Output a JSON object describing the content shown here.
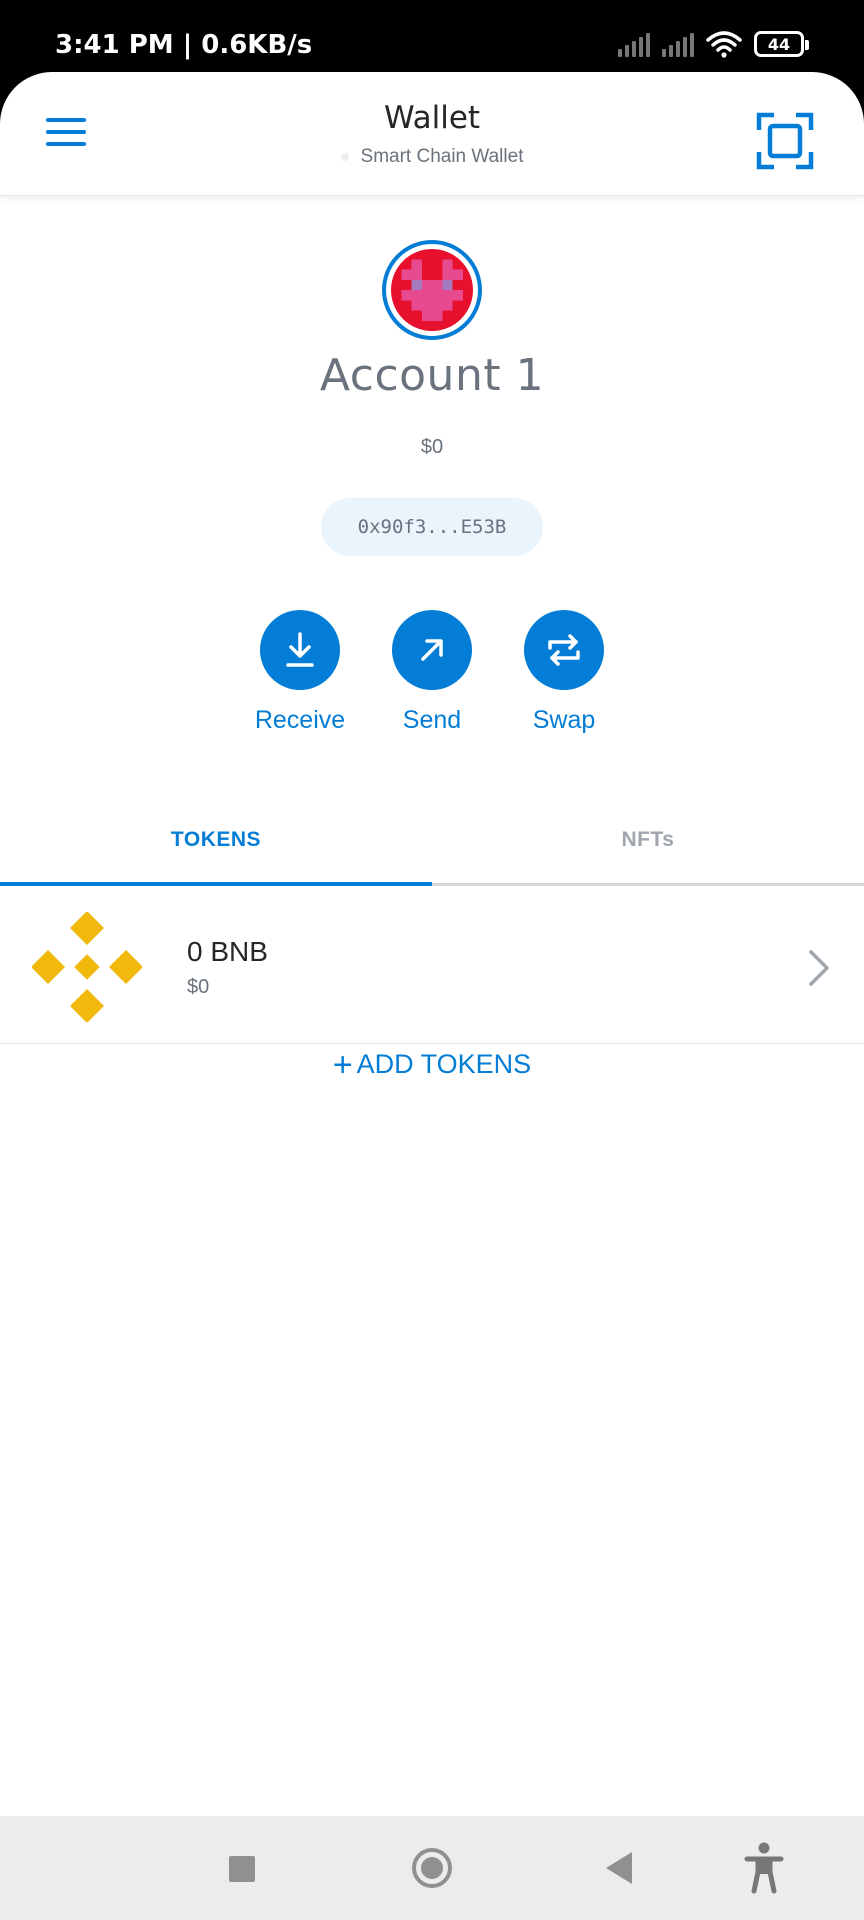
{
  "status_bar": {
    "time_speed": "3:41 PM | 0.6KB/s",
    "battery": "44",
    "icons": [
      "signal-icon",
      "signal-icon",
      "wifi-icon",
      "battery-icon"
    ]
  },
  "header": {
    "title": "Wallet",
    "network": "Smart Chain Wallet",
    "icons": [
      "hamburger-menu-icon",
      "scan-qr-icon"
    ]
  },
  "account": {
    "name": "Account 1",
    "balance": "$0",
    "address": "0x90f3...E53B"
  },
  "actions": [
    {
      "label": "Receive",
      "icon": "receive-download-icon"
    },
    {
      "label": "Send",
      "icon": "send-arrow-icon"
    },
    {
      "label": "Swap",
      "icon": "swap-arrows-icon"
    }
  ],
  "tabs": {
    "tokens": "TOKENS",
    "nfts": "NFTs",
    "active": "TOKENS"
  },
  "tokens": [
    {
      "amount": "0 BNB",
      "value": "$0",
      "icon": "bnb-logo-icon"
    }
  ],
  "add_tokens": {
    "plus": "+",
    "label": "ADD TOKENS"
  },
  "colors": {
    "accent": "#037dd6",
    "bnb": "#f0b90b",
    "avatar_red": "#e8112d",
    "avatar_pink": "#e84a8f"
  },
  "nav_bar": {
    "icons": [
      "recent-apps-square-icon",
      "home-circle-icon",
      "back-triangle-icon",
      "accessibility-icon"
    ]
  }
}
